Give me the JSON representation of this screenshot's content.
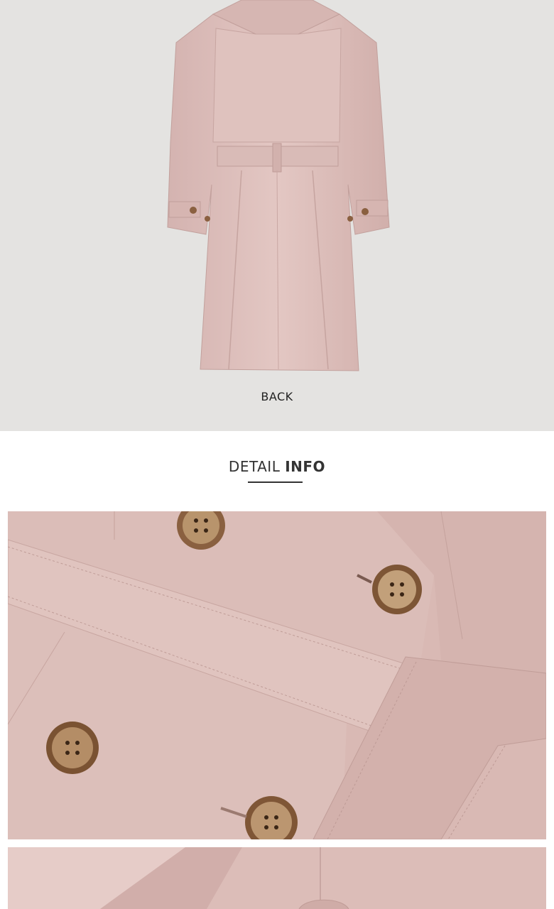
{
  "back_label": "BACK",
  "detail_header": {
    "light": "DETAIL",
    "bold": "INFO"
  },
  "colors": {
    "background_top": "#e4e3e1",
    "coat_pink": "#dcbcb8",
    "button_brown": "#8a6040",
    "header_text": "#333333"
  }
}
